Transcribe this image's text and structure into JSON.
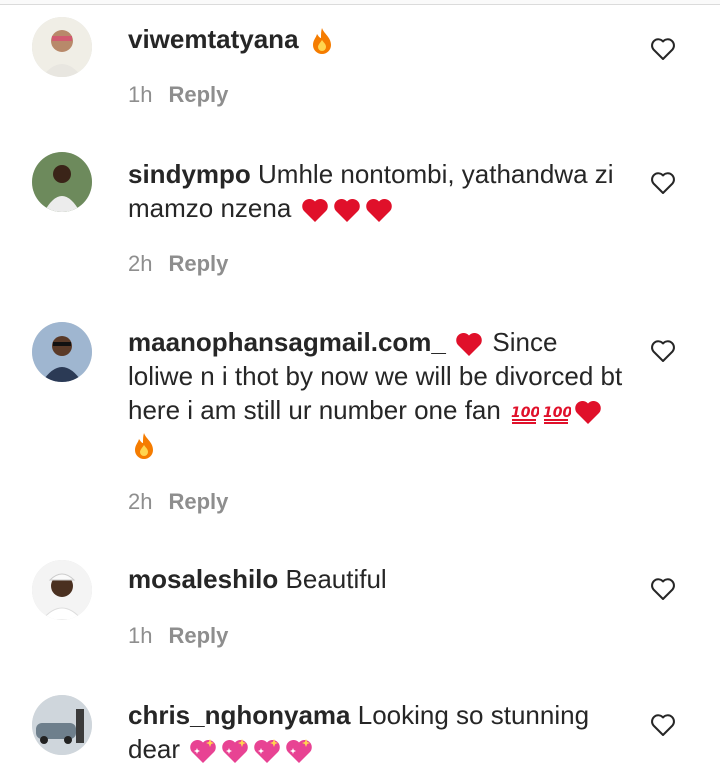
{
  "comments": [
    {
      "username": "viwemtatyana",
      "text": "",
      "emojis": [
        "fire"
      ],
      "time": "1h",
      "reply_label": "Reply"
    },
    {
      "username": "sindympo",
      "text": "Umhle nontombi, yathandwa zi mamzo nzena",
      "emojis": [
        "red-heart",
        "red-heart",
        "red-heart"
      ],
      "time": "2h",
      "reply_label": "Reply"
    },
    {
      "username": "maanophansagmail.com_",
      "text_before": "",
      "text": "Since loliwe n i thot by now we will be divorced bt here i am still ur number one fan",
      "emojis_before": [
        "red-heart"
      ],
      "emojis": [
        "hundred-points",
        "hundred-points",
        "red-heart",
        "fire"
      ],
      "time": "2h",
      "reply_label": "Reply"
    },
    {
      "username": "mosaleshilo",
      "text": "Beautiful",
      "emojis": [],
      "time": "1h",
      "reply_label": "Reply"
    },
    {
      "username": "chris_nghonyama",
      "text": "Looking so stunning dear",
      "emojis": [
        "sparkling-heart",
        "sparkling-heart",
        "sparkling-heart",
        "sparkling-heart"
      ],
      "time": "",
      "reply_label": ""
    }
  ],
  "icons": {
    "like": "heart-outline-icon"
  },
  "colors": {
    "text": "#262626",
    "meta": "#8e8e8e",
    "emoji_heart": "#e0102a",
    "emoji_fire": "#f57c00",
    "emoji_sparkle": "#e84393"
  }
}
